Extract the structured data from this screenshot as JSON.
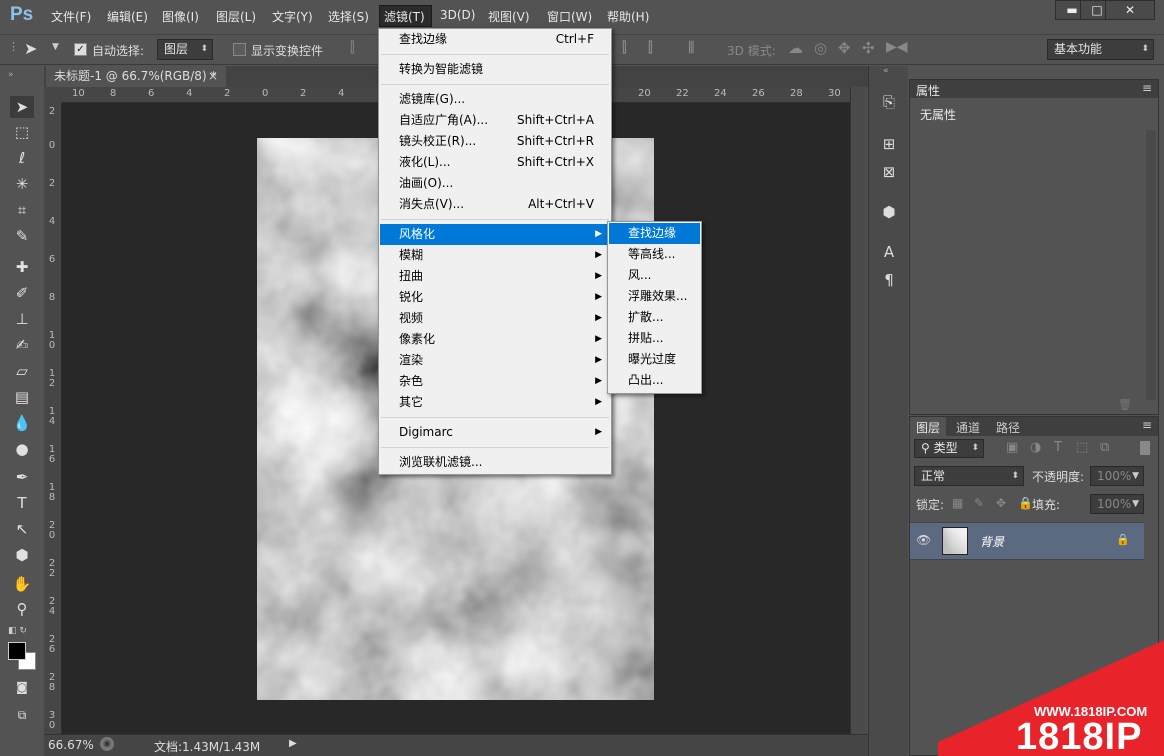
{
  "app_logo": "Ps",
  "menubar": [
    "文件(F)",
    "编辑(E)",
    "图像(I)",
    "图层(L)",
    "文字(Y)",
    "选择(S)",
    "滤镜(T)",
    "3D(D)",
    "视图(V)",
    "窗口(W)",
    "帮助(H)"
  ],
  "window_controls": {
    "minimize": "▬",
    "maximize": "□",
    "close": "✕"
  },
  "options": {
    "auto_select_label": "自动选择:",
    "auto_select_value": "图层",
    "show_transform_label": "显示变换控件",
    "mode3d_label": "3D 模式:",
    "workspace": "基本功能"
  },
  "document_tab": "未标题-1 @ 66.7%(RGB/8) *",
  "doc_tab_close": "×",
  "ruler_top": [
    "10",
    "8",
    "6",
    "4",
    "2",
    "0",
    "2",
    "4",
    "20",
    "22",
    "24",
    "26",
    "28",
    "30"
  ],
  "ruler_left": [
    "2",
    "0",
    "2",
    "4",
    "6",
    "8",
    "10",
    "12",
    "14",
    "16",
    "18",
    "20",
    "22",
    "24",
    "26",
    "28",
    "30"
  ],
  "status": {
    "zoom": "66.67%",
    "doc": "文档:1.43M/1.43M"
  },
  "properties": {
    "tab": "属性",
    "content": "无属性"
  },
  "layers_panel": {
    "tabs": [
      "图层",
      "通道",
      "路径"
    ],
    "filter_label": "类型",
    "blend_mode": "正常",
    "opacity_label": "不透明度:",
    "opacity_value": "100%",
    "lock_label": "锁定:",
    "fill_label": "填充:",
    "fill_value": "100%",
    "layer_name": "背景"
  },
  "filter_menu": {
    "items": [
      {
        "label": "查找边缘",
        "shortcut": "Ctrl+F"
      },
      {
        "label": "转换为智能滤镜",
        "shortcut": ""
      },
      {
        "label": "滤镜库(G)...",
        "shortcut": ""
      },
      {
        "label": "自适应广角(A)...",
        "shortcut": "Shift+Ctrl+A"
      },
      {
        "label": "镜头校正(R)...",
        "shortcut": "Shift+Ctrl+R"
      },
      {
        "label": "液化(L)...",
        "shortcut": "Shift+Ctrl+X"
      },
      {
        "label": "油画(O)...",
        "shortcut": ""
      },
      {
        "label": "消失点(V)...",
        "shortcut": "Alt+Ctrl+V"
      },
      {
        "label": "风格化",
        "shortcut": ""
      },
      {
        "label": "模糊",
        "shortcut": ""
      },
      {
        "label": "扭曲",
        "shortcut": ""
      },
      {
        "label": "锐化",
        "shortcut": ""
      },
      {
        "label": "视频",
        "shortcut": ""
      },
      {
        "label": "像素化",
        "shortcut": ""
      },
      {
        "label": "渲染",
        "shortcut": ""
      },
      {
        "label": "杂色",
        "shortcut": ""
      },
      {
        "label": "其它",
        "shortcut": ""
      },
      {
        "label": "Digimarc",
        "shortcut": ""
      },
      {
        "label": "浏览联机滤镜...",
        "shortcut": ""
      }
    ]
  },
  "stylize_submenu": [
    "查找边缘",
    "等高线...",
    "风...",
    "浮雕效果...",
    "扩散...",
    "拼贴...",
    "曝光过度",
    "凸出..."
  ],
  "watermark": {
    "url": "WWW.1818IP.COM",
    "brand": "1818IP"
  }
}
